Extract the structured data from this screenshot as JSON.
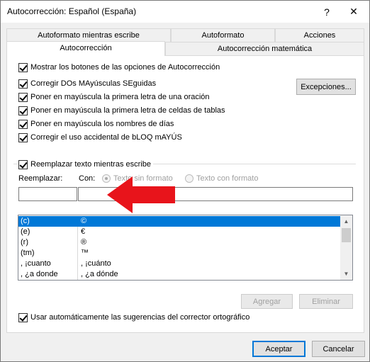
{
  "window": {
    "title": "Autocorrección: Español (España)",
    "help_glyph": "?",
    "close_glyph": "✕"
  },
  "tabs": {
    "back_row": [
      "Autoformato mientras escribe",
      "Autoformato",
      "Acciones"
    ],
    "front_row": [
      "Autocorrección",
      "Autocorrección matemática"
    ],
    "active": "Autocorrección"
  },
  "options": {
    "show_buttons": "Mostrar los botones de las opciones de Autocorrección",
    "two_caps": "Corregir DOs MAyúsculas SEguidas",
    "first_sentence": "Poner en mayúscula la primera letra de una oración",
    "first_cell": "Poner en mayúscula la primera letra de celdas de tablas",
    "days": "Poner en mayúscula los nombres de días",
    "caps_lock": "Corregir el uso accidental de bLOQ mAYÚS",
    "exceptions_button": "Excepciones..."
  },
  "replace": {
    "toggle_label": "Reemplazar texto mientras escribe",
    "replace_label": "Reemplazar:",
    "with_label": "Con:",
    "radio_plain": "Texto sin formato",
    "radio_formatted": "Texto con formato",
    "replace_value": "",
    "with_value": ""
  },
  "list": {
    "rows": [
      {
        "from": "(c)",
        "to": "©",
        "selected": true
      },
      {
        "from": "(e)",
        "to": "€",
        "selected": false
      },
      {
        "from": "(r)",
        "to": "®",
        "selected": false
      },
      {
        "from": "(tm)",
        "to": "™",
        "selected": false
      },
      {
        "from": ", ¡cuanto",
        "to": ", ¡cuánto",
        "selected": false
      },
      {
        "from": ", ¿a donde",
        "to": ", ¿a dónde",
        "selected": false
      }
    ]
  },
  "actions": {
    "add": "Agregar",
    "delete": "Eliminar"
  },
  "spelling": {
    "label": "Usar automáticamente las sugerencias del corrector ortográfico"
  },
  "footer": {
    "ok": "Aceptar",
    "cancel": "Cancelar"
  },
  "colors": {
    "selection": "#0078d7",
    "arrow": "#e8141b"
  }
}
